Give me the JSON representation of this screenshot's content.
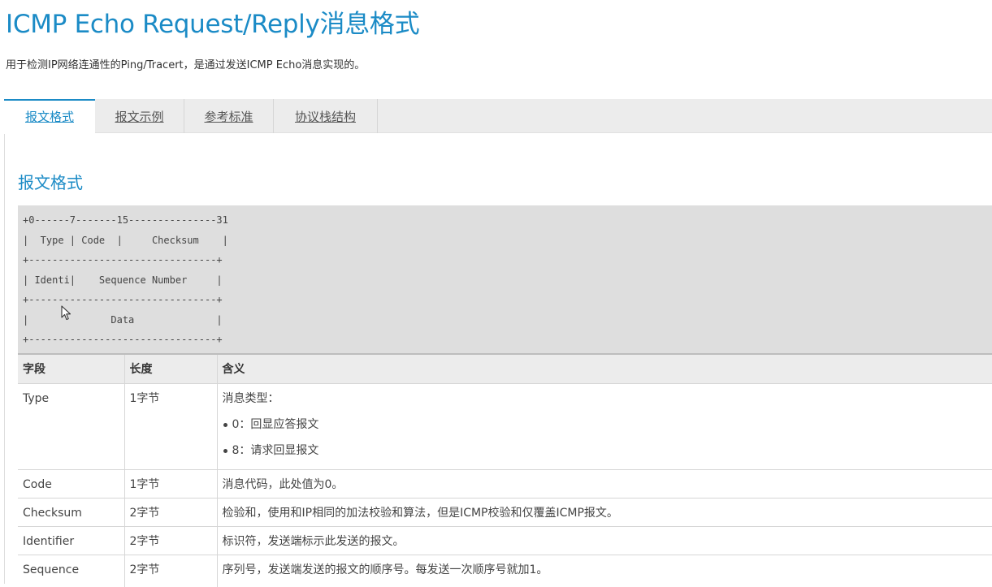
{
  "page": {
    "title": "ICMP Echo Request/Reply消息格式",
    "description": "用于检测IP网络连通性的Ping/Tracert，是通过发送ICMP Echo消息实现的。"
  },
  "tabs": [
    {
      "label": "报文格式",
      "active": true
    },
    {
      "label": "报文示例",
      "active": false
    },
    {
      "label": "参考标准",
      "active": false
    },
    {
      "label": "协议栈结构",
      "active": false
    }
  ],
  "section": {
    "title": "报文格式"
  },
  "format_diagram": "+0------7-------15---------------31\n|  Type | Code  |     Checksum    |\n+--------------------------------+\n| Identi|    Sequence Number     |\n+--------------------------------+\n|              Data              |\n+--------------------------------+",
  "cursor_icon": "mouse-pointer-icon",
  "table": {
    "headers": [
      "字段",
      "长度",
      "含义"
    ],
    "rows": [
      {
        "field": "Type",
        "length": "1字节",
        "meaning": "消息类型：",
        "bullets": [
          "0：回显应答报文",
          "8：请求回显报文"
        ]
      },
      {
        "field": "Code",
        "length": "1字节",
        "meaning": "消息代码，此处值为0。"
      },
      {
        "field": "Checksum",
        "length": "2字节",
        "meaning": "检验和，使用和IP相同的加法校验和算法，但是ICMP校验和仅覆盖ICMP报文。"
      },
      {
        "field": "Identifier",
        "length": "2字节",
        "meaning": "标识符，发送端标示此发送的报文。"
      },
      {
        "field": "Sequence",
        "length": "2字节",
        "meaning": "序列号，发送端发送的报文的顺序号。每发送一次顺序号就加1。"
      }
    ]
  },
  "colors": {
    "accent": "#1b8bc6",
    "code_background": "#dedede",
    "tab_bar": "#ececec"
  }
}
